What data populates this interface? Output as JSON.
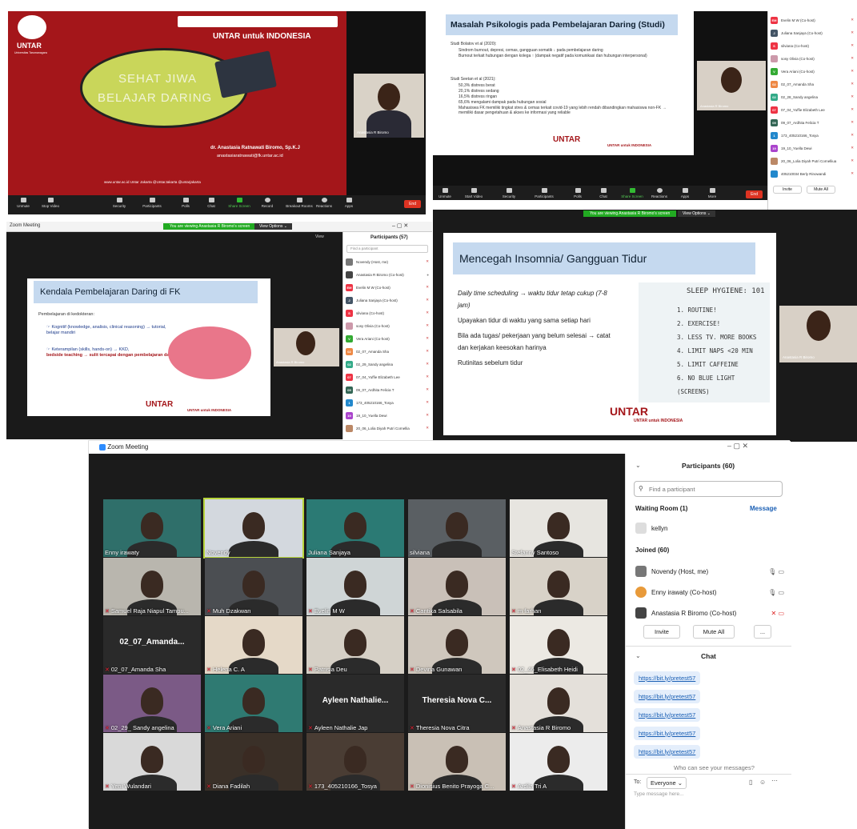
{
  "panel1": {
    "brand": "UNTAR",
    "brand_sub": "Universitas Tarumanagara",
    "tagline": "UNTAR untuk INDONESIA",
    "slide_title_1": "SEHAT JIWA",
    "slide_title_2": "BELAJAR DARING",
    "presenter": "dr. Anastasia Ratnawati Biromo, Sp.K.J",
    "email": "anastasiaratnawati@fk.untar.ac.id",
    "socials": "www.untar.ac.id   Untar Jakarta   @UntarJakarta   @untarjakarta",
    "cam_label": "Anastasia R Biromo",
    "toolbar": [
      "Unmute",
      "Stop Video",
      "Security",
      "Participants",
      "Polls",
      "Chat",
      "Share Screen",
      "Record",
      "Breakout Rooms",
      "Reactions",
      "Apps"
    ],
    "end": "End"
  },
  "panel2": {
    "slide_title": "Masalah Psikologis pada Pembelajaran Daring (Studi)",
    "study1": "Studi Bolatov et al (2020):",
    "study1_items": [
      "Sindrom burnout, depresi, cemas, gangguan somatik ↓ pada pembelajaran daring",
      "Burnout terkait hubungan dengan kolega ↑ (dampak negatif pada komunikasi dan hubungan interpersonal)"
    ],
    "study2": "Studi Seetan et al (2021):",
    "study2_items": [
      "50,3% distress berat",
      "20,1% distress sedang",
      "16,5% distress ringan",
      "65,6% mengalami dampak pada hubungan sosial",
      "Mahasiswa FK memiliki tingkat stres & cemas terkait covid-19 yang lebih rendah dibandingkan mahasiswa non-FK → memiliki dasar pengetahuan & akses ke informasi yang reliable"
    ],
    "footer": "UNTAR untuk INDONESIA",
    "cam_label": "Anastasia R Biromo",
    "participants": [
      "Evelin M W (Co-host)",
      "Juliana Sanjaya (Co-host)",
      "silviana (Co-host)",
      "sosy Olivia (Co-host)",
      "Vera Ariani (Co-host)",
      "02_07_Amanda Sha",
      "02_28_Sandy angelina",
      "07_04_Yuffie Elizabeth Lee",
      "09_07_Ardhita Felicia T",
      "173_405210166_Tosya",
      "19_10_Yuella Dewi",
      "20_06_Lolia Diyah Putri Cornelliua",
      "405210034 Berly Rinowandi"
    ],
    "invite": "Invite",
    "mute_all": "Mute All",
    "toolbar": [
      "Unmute",
      "Start Video",
      "Security",
      "Participants",
      "Polls",
      "Chat",
      "Share Screen",
      "Reactions",
      "Apps",
      "More"
    ],
    "end": "End"
  },
  "panel3": {
    "window_title": "Zoom Meeting",
    "viewing": "You are viewing Anastasia R Biromo's screen",
    "view_options": "View Options ⌄",
    "view": "View",
    "slide_title": "Kendala Pembelajaran Daring di FK",
    "lead": "Pembelajaran di kedokteran:",
    "item1": "☞ Kognitif (knowledge, analisis, clinical reasoning) → tutorial, belajar mandiri",
    "item2a": "☞ Keterampilan (skills, hands-on) → KKD,",
    "item2b": "bedside teaching → sulit tercapai dengan pembelajaran daring",
    "footer": "UNTAR untuk INDONESIA",
    "cam_label": "Anastasia R Biromo",
    "participants_header": "Participants (57)",
    "search_placeholder": "Find a participant",
    "participants": [
      "Novendy (Host, me)",
      "Anastasia R Biromo (Co-host)",
      "Evelin M W (Co-host)",
      "Juliana Sanjaya (Co-host)",
      "silviana (Co-host)",
      "sosy Olivia (Co-host)",
      "Vera Ariani (Co-host)",
      "02_07_Amanda Sha",
      "02_29_Sandy angelina",
      "07_04_Yuffie Elizabeth Lee",
      "09_07_Ardhita Felicia T",
      "173_405210166_Tosya",
      "19_10_Yuella Dewi",
      "20_06_Lolia Diyah Putri Cornellia"
    ]
  },
  "panel4": {
    "viewing": "You are viewing Anastasia R Biromo's screen",
    "view_options": "View Options ⌄",
    "slide_title": "Mencegah Insomnia/ Gangguan Tidur",
    "items": [
      "Daily time scheduling → waktu tidur tetap cukup (7-8 jam)",
      "Upayakan tidur di waktu yang sama setiap hari",
      "Bila ada tugas/ pekerjaan yang belum selesai → catat dan kerjakan keesokan harinya",
      "Rutinitas sebelum tidur"
    ],
    "hygiene_title": "SLEEP HYGIENE: 101",
    "hygiene": [
      "1. ROUTINE!",
      "2. EXERCISE!",
      "3. LESS TV. MORE BOOKS",
      "4. LIMIT NAPS <20 MIN",
      "5. LIMIT CAFFEINE",
      "6. NO BLUE LIGHT (SCREENS)"
    ],
    "brand": "UNTAR",
    "footer": "UNTAR untuk INDONESIA",
    "cam_label": "Anastasia R Biromo"
  },
  "main": {
    "window_title": "Zoom Meeting",
    "tiles": [
      {
        "name": "Enny irawaty",
        "muted": false
      },
      {
        "name": "Novendy",
        "muted": false
      },
      {
        "name": "Juliana Sanjaya",
        "muted": false
      },
      {
        "name": "silviana",
        "muted": false
      },
      {
        "name": "Stefanny Santoso",
        "muted": false
      },
      {
        "name": "Samuel Raja Niapul Tampu...",
        "muted": true
      },
      {
        "name": "Muh Dzakwan",
        "muted": true
      },
      {
        "name": "Evelin M W",
        "muted": true
      },
      {
        "name": "Cantika Salsabila",
        "muted": true
      },
      {
        "name": "m farhan",
        "muted": true
      },
      {
        "name": "02_07_Amanda Sha",
        "muted": true,
        "big": "02_07_Amanda..."
      },
      {
        "name": "Helena C. A",
        "muted": true
      },
      {
        "name": "Patrisia Deu",
        "muted": true
      },
      {
        "name": "Devina Gunawan",
        "muted": true
      },
      {
        "name": "02_46_Elisabeth Heidi",
        "muted": true
      },
      {
        "name": "02_29_ Sandy angelina",
        "muted": true
      },
      {
        "name": "Vera Ariani",
        "muted": true
      },
      {
        "name": "Ayleen Nathalie Jap",
        "muted": true,
        "big": "Ayleen Nathalie..."
      },
      {
        "name": "Theresia Nova Citra",
        "muted": true,
        "big": "Theresia Nova C..."
      },
      {
        "name": "Anastasia R Biromo",
        "muted": true
      },
      {
        "name": "Yeni Wulandari",
        "muted": true
      },
      {
        "name": "Diana Fadilah",
        "muted": true
      },
      {
        "name": "173_405210166_Tosya",
        "muted": true
      },
      {
        "name": "Dionisius Benito Prayoga C...",
        "muted": true
      },
      {
        "name": "Ardila Tri A",
        "muted": true
      }
    ],
    "participants_header": "Participants (60)",
    "search_placeholder": "Find a participant",
    "waiting_room": "Waiting Room (1)",
    "message": "Message",
    "waiting_user": "kellyn",
    "joined": "Joined (60)",
    "joined_list": [
      "Novendy (Host, me)",
      "Enny irawaty (Co-host)",
      "Anastasia R Biromo (Co-host)"
    ],
    "invite": "Invite",
    "mute_all": "Mute All",
    "more": "...",
    "chat_header": "Chat",
    "chat_messages": [
      "https://bit.ly/pretest57",
      "https://bit.ly/pretest57",
      "https://bit.ly/pretest57",
      "https://bit.ly/pretest57",
      "https://bit.ly/pretest57"
    ],
    "who_can_see": "Who can see your messages?",
    "to_label": "To:",
    "to_value": "Everyone ⌄",
    "type_placeholder": "Type message here..."
  }
}
